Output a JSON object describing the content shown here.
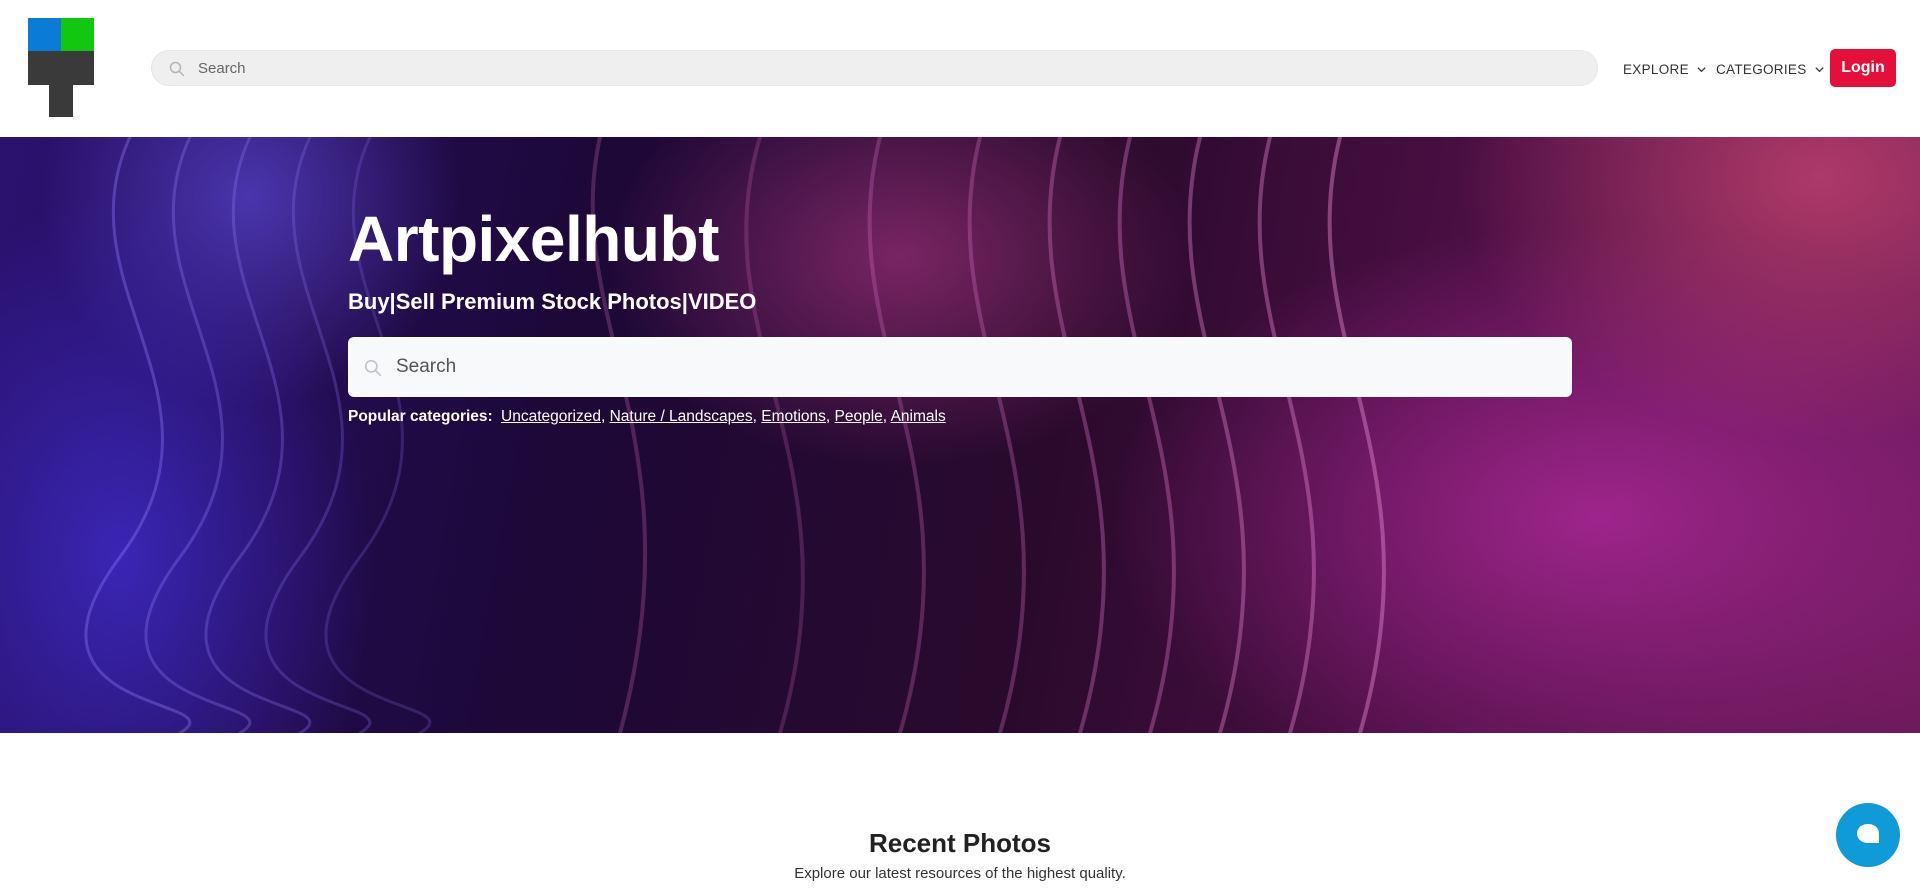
{
  "header": {
    "search_placeholder": "Search",
    "nav": {
      "explore": "EXPLORE",
      "categories": "CATEGORIES"
    },
    "login_label": "Login",
    "logo_colors": {
      "blue": "#0a7bd6",
      "green": "#12c70f",
      "dark": "#3a3a3a"
    }
  },
  "hero": {
    "title": "Artpixelhubt",
    "subtitle": "Buy|Sell Premium Stock Photos|VIDEO",
    "search_placeholder": "Search",
    "popular_label": "Popular categories:",
    "categories": [
      "Uncategorized",
      "Nature / Landscapes",
      "Emotions",
      "People",
      "Animals"
    ]
  },
  "recent": {
    "title": "Recent Photos",
    "subtitle": "Explore our latest resources of the highest quality."
  },
  "colors": {
    "accent": "#e4103a",
    "chat": "#0e9bd8"
  },
  "icons": {
    "search": "search-icon",
    "chevron": "chevron-down-icon",
    "chat": "chat-bubble-icon"
  }
}
